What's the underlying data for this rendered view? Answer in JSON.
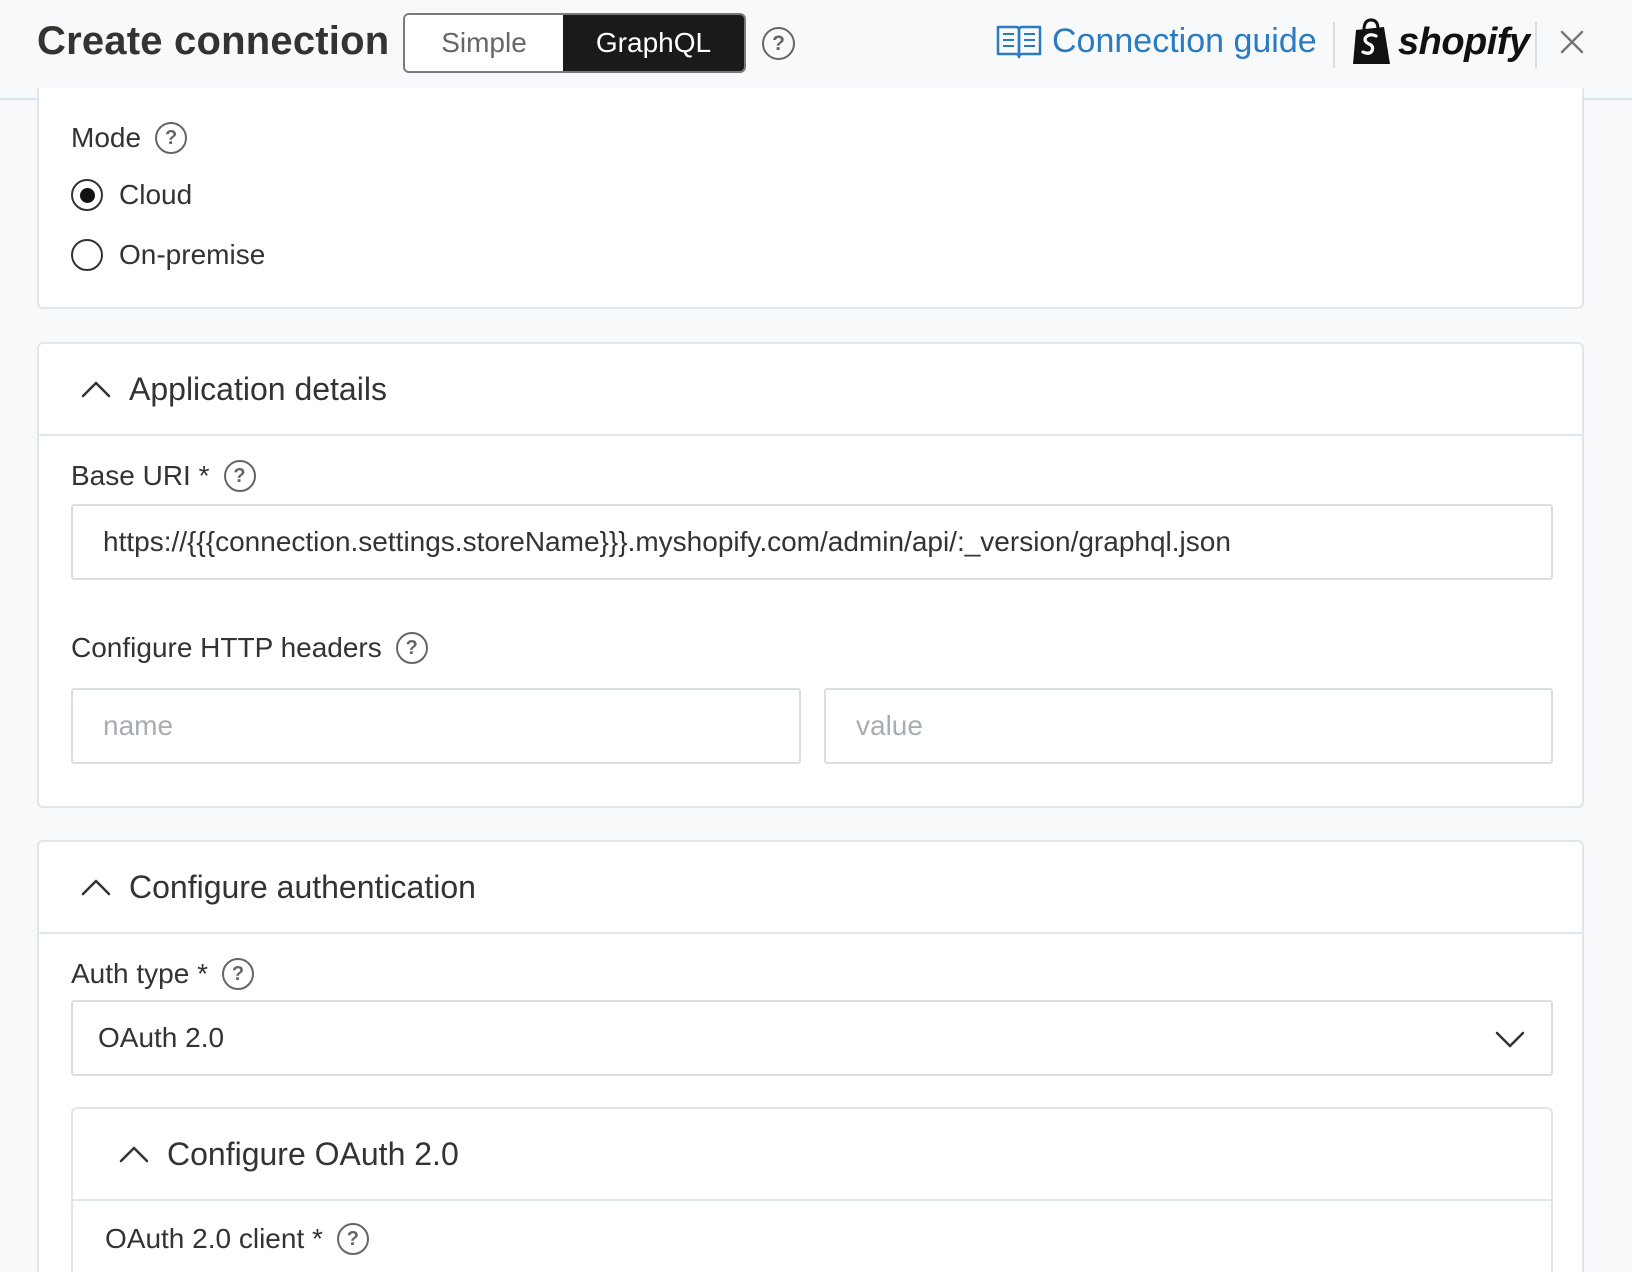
{
  "header": {
    "title": "Create connection",
    "toggle": {
      "simple_label": "Simple",
      "graphql_label": "GraphQL",
      "active": "GraphQL"
    },
    "help_glyph": "?",
    "guide_label": "Connection guide",
    "brand": "shopify",
    "icons": {
      "guide": "book-icon",
      "brand": "shopify-bag-icon",
      "close": "close-icon",
      "help": "help-circle-icon"
    }
  },
  "mode": {
    "label": "Mode",
    "options": [
      {
        "label": "Cloud",
        "selected": true
      },
      {
        "label": "On-premise",
        "selected": false
      }
    ]
  },
  "application_details": {
    "title": "Application details",
    "base_uri_label": "Base URI *",
    "base_uri_value": "https://{{{connection.settings.storeName}}}.myshopify.com/admin/api/:_version/graphql.json",
    "headers_label": "Configure HTTP headers",
    "header_name_placeholder": "name",
    "header_value_placeholder": "value"
  },
  "authentication": {
    "title": "Configure authentication",
    "auth_type_label": "Auth type *",
    "auth_type_value": "OAuth 2.0",
    "oauth": {
      "title": "Configure OAuth 2.0",
      "client_label": "OAuth 2.0 client *"
    }
  },
  "colors": {
    "accent": "#2b7bc0",
    "toggle_active_bg": "#1a1a1a",
    "border": "#dfe6ec",
    "background": "#f7f9fb"
  }
}
